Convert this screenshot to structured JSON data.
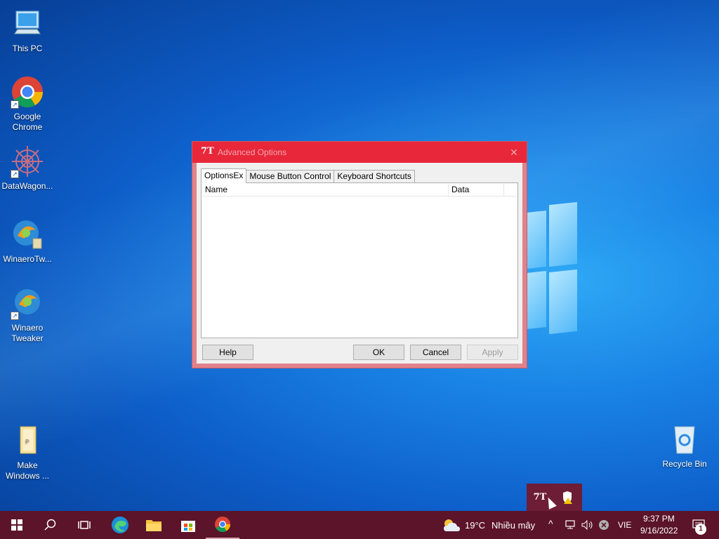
{
  "desktop": {
    "icons": [
      {
        "label": "This PC",
        "icon": "computer-icon"
      },
      {
        "label": "Google Chrome",
        "icon": "chrome-icon"
      },
      {
        "label": "DataWagon...",
        "icon": "datawagon-icon"
      },
      {
        "label": "WinaeroTw...",
        "icon": "winaero-tweaker-icon"
      },
      {
        "label": "Winaero Tweaker",
        "icon": "winaero-tweaker-icon"
      },
      {
        "label": "Make Windows ...",
        "icon": "folder-icon"
      },
      {
        "label": "Recycle Bin",
        "icon": "recycle-bin-icon"
      }
    ]
  },
  "dialog": {
    "title": "Advanced Options",
    "app_icon": "7T",
    "close_glyph": "✕",
    "tabs": [
      {
        "label": "OptionsEx",
        "active": true
      },
      {
        "label": "Mouse Button Control",
        "active": false
      },
      {
        "label": "Keyboard Shortcuts",
        "active": false
      }
    ],
    "columns": [
      "Name",
      "Data"
    ],
    "buttons": {
      "help": "Help",
      "ok": "OK",
      "cancel": "Cancel",
      "apply": "Apply"
    }
  },
  "tray_popup": {
    "icons": [
      "7tt-icon",
      "security-warning-icon"
    ]
  },
  "taskbar": {
    "weather_temp": "19°C",
    "weather_desc": "Nhiều mây",
    "language": "VIE",
    "time": "9:37 PM",
    "date": "9/16/2022",
    "notification_count": "1"
  },
  "colors": {
    "accent": "#e8273a",
    "taskbar": "#5b1429"
  }
}
